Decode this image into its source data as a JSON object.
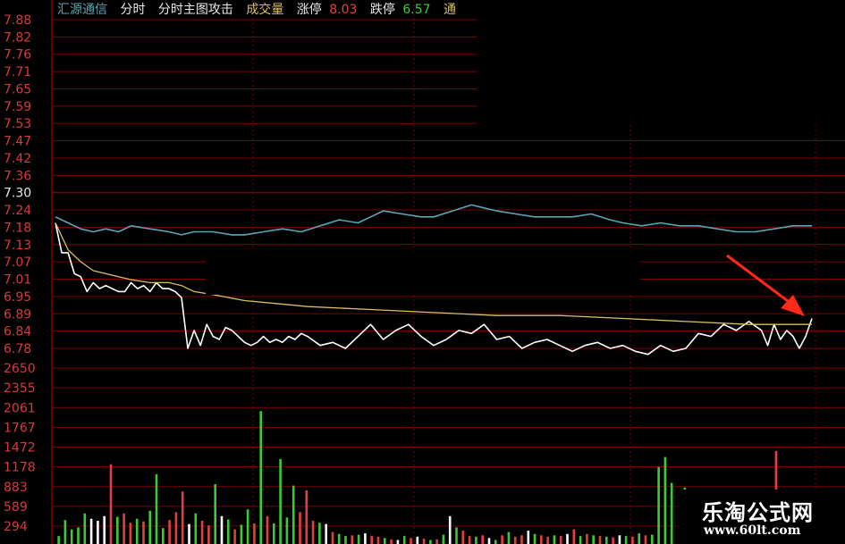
{
  "header": {
    "stock_name": "汇源通信",
    "mode": "分时",
    "indicator": "分时主图攻击",
    "volume_label": "成交量",
    "limit_up_label": "涨停",
    "limit_up_value": "8.03",
    "limit_down_label": "跌停",
    "limit_down_value": "6.57",
    "truncated_label": "通"
  },
  "watermark": {
    "title": "乐淘公式网",
    "url": "www.60lt.com"
  },
  "colors": {
    "background": "#000000",
    "grid": "#7a0000",
    "axis_text": "#d83a3a",
    "price_line": "#ffffff",
    "avg_line": "#d8c060",
    "indicator_line": "#5aa6b8",
    "up_bar": "#e04040",
    "down_bar": "#3cc93c",
    "flat_bar": "#ffffff",
    "arrow": "#ff2a1a"
  },
  "chart_data": [
    {
      "type": "line",
      "title": "",
      "yticks": [
        "7.88",
        "7.82",
        "7.76",
        "7.71",
        "7.65",
        "7.59",
        "7.53",
        "7.47",
        "7.42",
        "7.36",
        "7.30",
        "7.24",
        "7.18",
        "7.13",
        "7.07",
        "7.01",
        "6.95",
        "6.89",
        "6.84",
        "6.78"
      ],
      "ylim": [
        6.75,
        7.88
      ],
      "xlim": [
        0,
        240
      ],
      "series": [
        {
          "name": "",
          "role": "price",
          "x": [
            0,
            2,
            4,
            6,
            8,
            10,
            12,
            14,
            16,
            18,
            20,
            22,
            24,
            26,
            28,
            30,
            32,
            34,
            36,
            38,
            40,
            42,
            44,
            46,
            48,
            50,
            52,
            54,
            56,
            58,
            60,
            62,
            64,
            66,
            68,
            70,
            72,
            74,
            76,
            78,
            80,
            84,
            88,
            92,
            96,
            100,
            104,
            108,
            112,
            116,
            120,
            124,
            128,
            132,
            136,
            140,
            144,
            148,
            152,
            156,
            160,
            164,
            168,
            172,
            176,
            180,
            184,
            188,
            192,
            196,
            200,
            204,
            208,
            212,
            216,
            220,
            224,
            226,
            228,
            230,
            232,
            234,
            236,
            238,
            240
          ],
          "y": [
            7.2,
            7.1,
            7.1,
            7.03,
            7.02,
            6.97,
            7.0,
            6.98,
            6.99,
            6.98,
            6.97,
            6.97,
            7.0,
            6.98,
            6.99,
            6.97,
            7.0,
            6.98,
            6.98,
            6.97,
            6.95,
            6.78,
            6.84,
            6.79,
            6.86,
            6.82,
            6.81,
            6.85,
            6.84,
            6.82,
            6.8,
            6.79,
            6.8,
            6.82,
            6.8,
            6.81,
            6.8,
            6.82,
            6.81,
            6.83,
            6.82,
            6.79,
            6.8,
            6.78,
            6.82,
            6.86,
            6.81,
            6.84,
            6.86,
            6.82,
            6.79,
            6.81,
            6.84,
            6.83,
            6.86,
            6.81,
            6.82,
            6.78,
            6.8,
            6.81,
            6.79,
            6.77,
            6.79,
            6.8,
            6.78,
            6.79,
            6.77,
            6.76,
            6.79,
            6.77,
            6.78,
            6.83,
            6.82,
            6.86,
            6.84,
            6.87,
            6.84,
            6.79,
            6.86,
            6.81,
            6.84,
            6.82,
            6.78,
            6.82,
            6.88
          ]
        },
        {
          "name": "",
          "role": "average",
          "x": [
            0,
            4,
            8,
            12,
            16,
            20,
            24,
            30,
            36,
            40,
            44,
            50,
            60,
            70,
            80,
            100,
            120,
            140,
            160,
            180,
            200,
            220,
            240
          ],
          "y": [
            7.2,
            7.11,
            7.07,
            7.04,
            7.03,
            7.02,
            7.01,
            7.0,
            7.0,
            6.99,
            6.97,
            6.96,
            6.94,
            6.93,
            6.92,
            6.91,
            6.9,
            6.89,
            6.89,
            6.88,
            6.87,
            6.86,
            6.86
          ]
        },
        {
          "name": "",
          "role": "indicator",
          "x": [
            0,
            4,
            8,
            12,
            16,
            20,
            24,
            30,
            36,
            40,
            44,
            50,
            56,
            60,
            66,
            72,
            78,
            84,
            90,
            96,
            100,
            104,
            110,
            116,
            120,
            126,
            132,
            136,
            140,
            146,
            152,
            158,
            164,
            170,
            176,
            180,
            186,
            192,
            198,
            204,
            210,
            216,
            222,
            228,
            234,
            240
          ],
          "y": [
            7.22,
            7.2,
            7.18,
            7.17,
            7.18,
            7.17,
            7.19,
            7.18,
            7.17,
            7.16,
            7.17,
            7.17,
            7.16,
            7.16,
            7.17,
            7.18,
            7.17,
            7.19,
            7.21,
            7.2,
            7.22,
            7.24,
            7.23,
            7.22,
            7.22,
            7.24,
            7.26,
            7.25,
            7.24,
            7.23,
            7.22,
            7.22,
            7.22,
            7.23,
            7.21,
            7.2,
            7.19,
            7.2,
            7.19,
            7.19,
            7.18,
            7.17,
            7.17,
            7.18,
            7.19,
            7.19
          ]
        }
      ]
    },
    {
      "type": "bar",
      "title": "",
      "yticks": [
        "2650",
        "2355",
        "2061",
        "1767",
        "1472",
        "1178",
        "883",
        "589",
        "294"
      ],
      "ylim": [
        0,
        2650
      ],
      "categories": [],
      "series": [
        {
          "name": "",
          "values": [
            120,
            360,
            220,
            250,
            460,
            380,
            350,
            420,
            1200,
            410,
            460,
            320,
            380,
            340,
            500,
            1050,
            240,
            360,
            480,
            790,
            300,
            460,
            350,
            280,
            900,
            420,
            370,
            220,
            290,
            520,
            310,
            2000,
            420,
            310,
            1280,
            400,
            880,
            480,
            810,
            350,
            320,
            300,
            180,
            150,
            120,
            130,
            140,
            160,
            120,
            110,
            90,
            70,
            60,
            120,
            90,
            110,
            80,
            60,
            70,
            140,
            420,
            250,
            200,
            120,
            110,
            130,
            90,
            60,
            130,
            180,
            110,
            130,
            200,
            150,
            130,
            110,
            130,
            120,
            150,
            220,
            120,
            150,
            130,
            120,
            110,
            100,
            130,
            120,
            110,
            160,
            130,
            140,
            1160,
            1310,
            920,
            700,
            850,
            610,
            540,
            420,
            410,
            650,
            580,
            430,
            460,
            410,
            380,
            360,
            310,
            340,
            1400,
            450,
            200,
            360,
            500,
            180
          ],
          "direction": [
            "down",
            "down",
            "down",
            "down",
            "down",
            "flat",
            "flat",
            "flat",
            "up",
            "down",
            "up",
            "up",
            "down",
            "up",
            "down",
            "down",
            "down",
            "up",
            "up",
            "up",
            "flat",
            "down",
            "up",
            "up",
            "down",
            "flat",
            "down",
            "up",
            "down",
            "down",
            "up",
            "down",
            "up",
            "down",
            "down",
            "down",
            "down",
            "up",
            "up",
            "up",
            "down",
            "flat",
            "up",
            "down",
            "down",
            "up",
            "down",
            "flat",
            "up",
            "up",
            "down",
            "up",
            "flat",
            "down",
            "up",
            "flat",
            "up",
            "down",
            "up",
            "down",
            "flat",
            "down",
            "up",
            "up",
            "down",
            "up",
            "flat",
            "down",
            "up",
            "down",
            "up",
            "up",
            "flat",
            "down",
            "up",
            "up",
            "down",
            "up",
            "flat",
            "up",
            "down",
            "up",
            "down",
            "up",
            "down",
            "up",
            "flat",
            "down",
            "up",
            "down",
            "up",
            "down",
            "down",
            "down",
            "down",
            "down",
            "down",
            "flat",
            "up",
            "down",
            "up",
            "down",
            "flat",
            "down",
            "up",
            "down",
            "up",
            "up",
            "down",
            "up",
            "up",
            "down",
            "down"
          ]
        }
      ]
    }
  ]
}
